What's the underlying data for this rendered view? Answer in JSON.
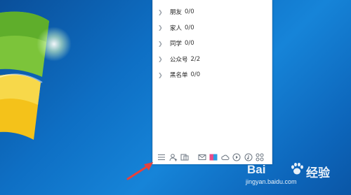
{
  "contacts": {
    "groups": [
      {
        "name": "朋友",
        "count": "0/0"
      },
      {
        "name": "家人",
        "count": "0/0"
      },
      {
        "name": "同学",
        "count": "0/0"
      },
      {
        "name": "公众号",
        "count": "2/2"
      },
      {
        "name": "黑名单",
        "count": "0/0"
      }
    ]
  },
  "toolbar": {
    "icons": [
      "menu-icon",
      "add-contact-icon",
      "app-manager-icon",
      "mail-icon",
      "gallery-icon",
      "cloud-icon",
      "video-icon",
      "music-icon",
      "apps-grid-icon"
    ]
  },
  "watermark": {
    "brand": "Bai",
    "brand_suffix": "经验",
    "url": "jingyan.baidu.com"
  },
  "colors": {
    "desktop_blue": "#0e6fc4",
    "arrow_red": "#e8413a",
    "panel_bg": "#ffffff"
  }
}
